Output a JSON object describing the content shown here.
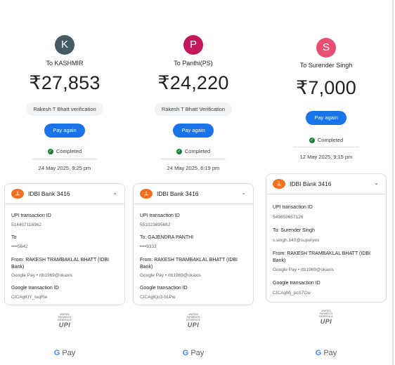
{
  "receipts": [
    {
      "avatar_initial": "K",
      "avatar_color": "#455a64",
      "to_label": "To KASHMIR",
      "amount": "₹27,853",
      "verification": "Rakesh T Bhatt verification",
      "pay_again": "Pay again",
      "status": "Completed",
      "datetime": "24 May 2025, 9:25 pm",
      "bank": "IDBI Bank 3416",
      "upi_id_label": "UPI transaction ID",
      "upi_id": "514407116962",
      "to_title": "To",
      "to_detail": "••••5642",
      "from_title": "From: RAKESH TRAMBAKLAL BHATT (IDBI Bank)",
      "from_detail": "Google Pay • rtb1969@okaxis",
      "gid_label": "Google transaction ID",
      "gid": "CICAgKIY_luqRw",
      "upi_logo": "UPI",
      "upi_logo_sub": "UNIFIED PAYMENTS INTERFACE",
      "gpay_g": "G",
      "gpay_text": "Pay"
    },
    {
      "avatar_initial": "P",
      "avatar_color": "#c2185b",
      "to_label": "To Panthi(PS)",
      "amount": "₹24,220",
      "verification": "Rakesh T Bhatt Verification",
      "pay_again": "Pay again",
      "status": "Completed",
      "datetime": "24 May 2025, 6:19 pm",
      "bank": "IDBI Bank 3416",
      "upi_id_label": "UPI transaction ID",
      "upi_id": "551023695662",
      "to_title": "To: GAJENDRA PANTHI",
      "to_detail": "••••9333",
      "from_title": "From: RAKESH TRAMBAKLAL BHATT (IDBI Bank)",
      "from_detail": "Google Pay • rtb1969@okaxis",
      "gid_label": "Google transaction ID",
      "gid": "CICAgKjo3-b1Pw",
      "upi_logo": "UPI",
      "upi_logo_sub": "UNIFIED PAYMENTS INTERFACE",
      "gpay_g": "G",
      "gpay_text": "Pay"
    },
    {
      "avatar_initial": "S",
      "avatar_color": "#e84f74",
      "to_label": "To Surender Singh",
      "amount": "₹7,000",
      "pay_again": "Pay again",
      "status": "Completed",
      "datetime": "12 May 2025, 9:15 pm",
      "bank": "IDBI Bank 3416",
      "upi_id_label": "UPI transaction ID",
      "upi_id": "549859657126",
      "to_title": "To: Surender Singh",
      "to_detail": "s.singh.140@superyes",
      "from_title": "From: RAKESH TRAMBAKLAL BHATT (IDBI Bank)",
      "from_detail": "Google Pay • rtb1969@okaxis",
      "gid_label": "Google transaction ID",
      "gid": "CICAgMj_pcS7Cw",
      "upi_logo": "UPI",
      "upi_logo_sub": "UNIFIED PAYMENTS INTERFACE",
      "gpay_g": "G",
      "gpay_text": "Pay"
    }
  ]
}
